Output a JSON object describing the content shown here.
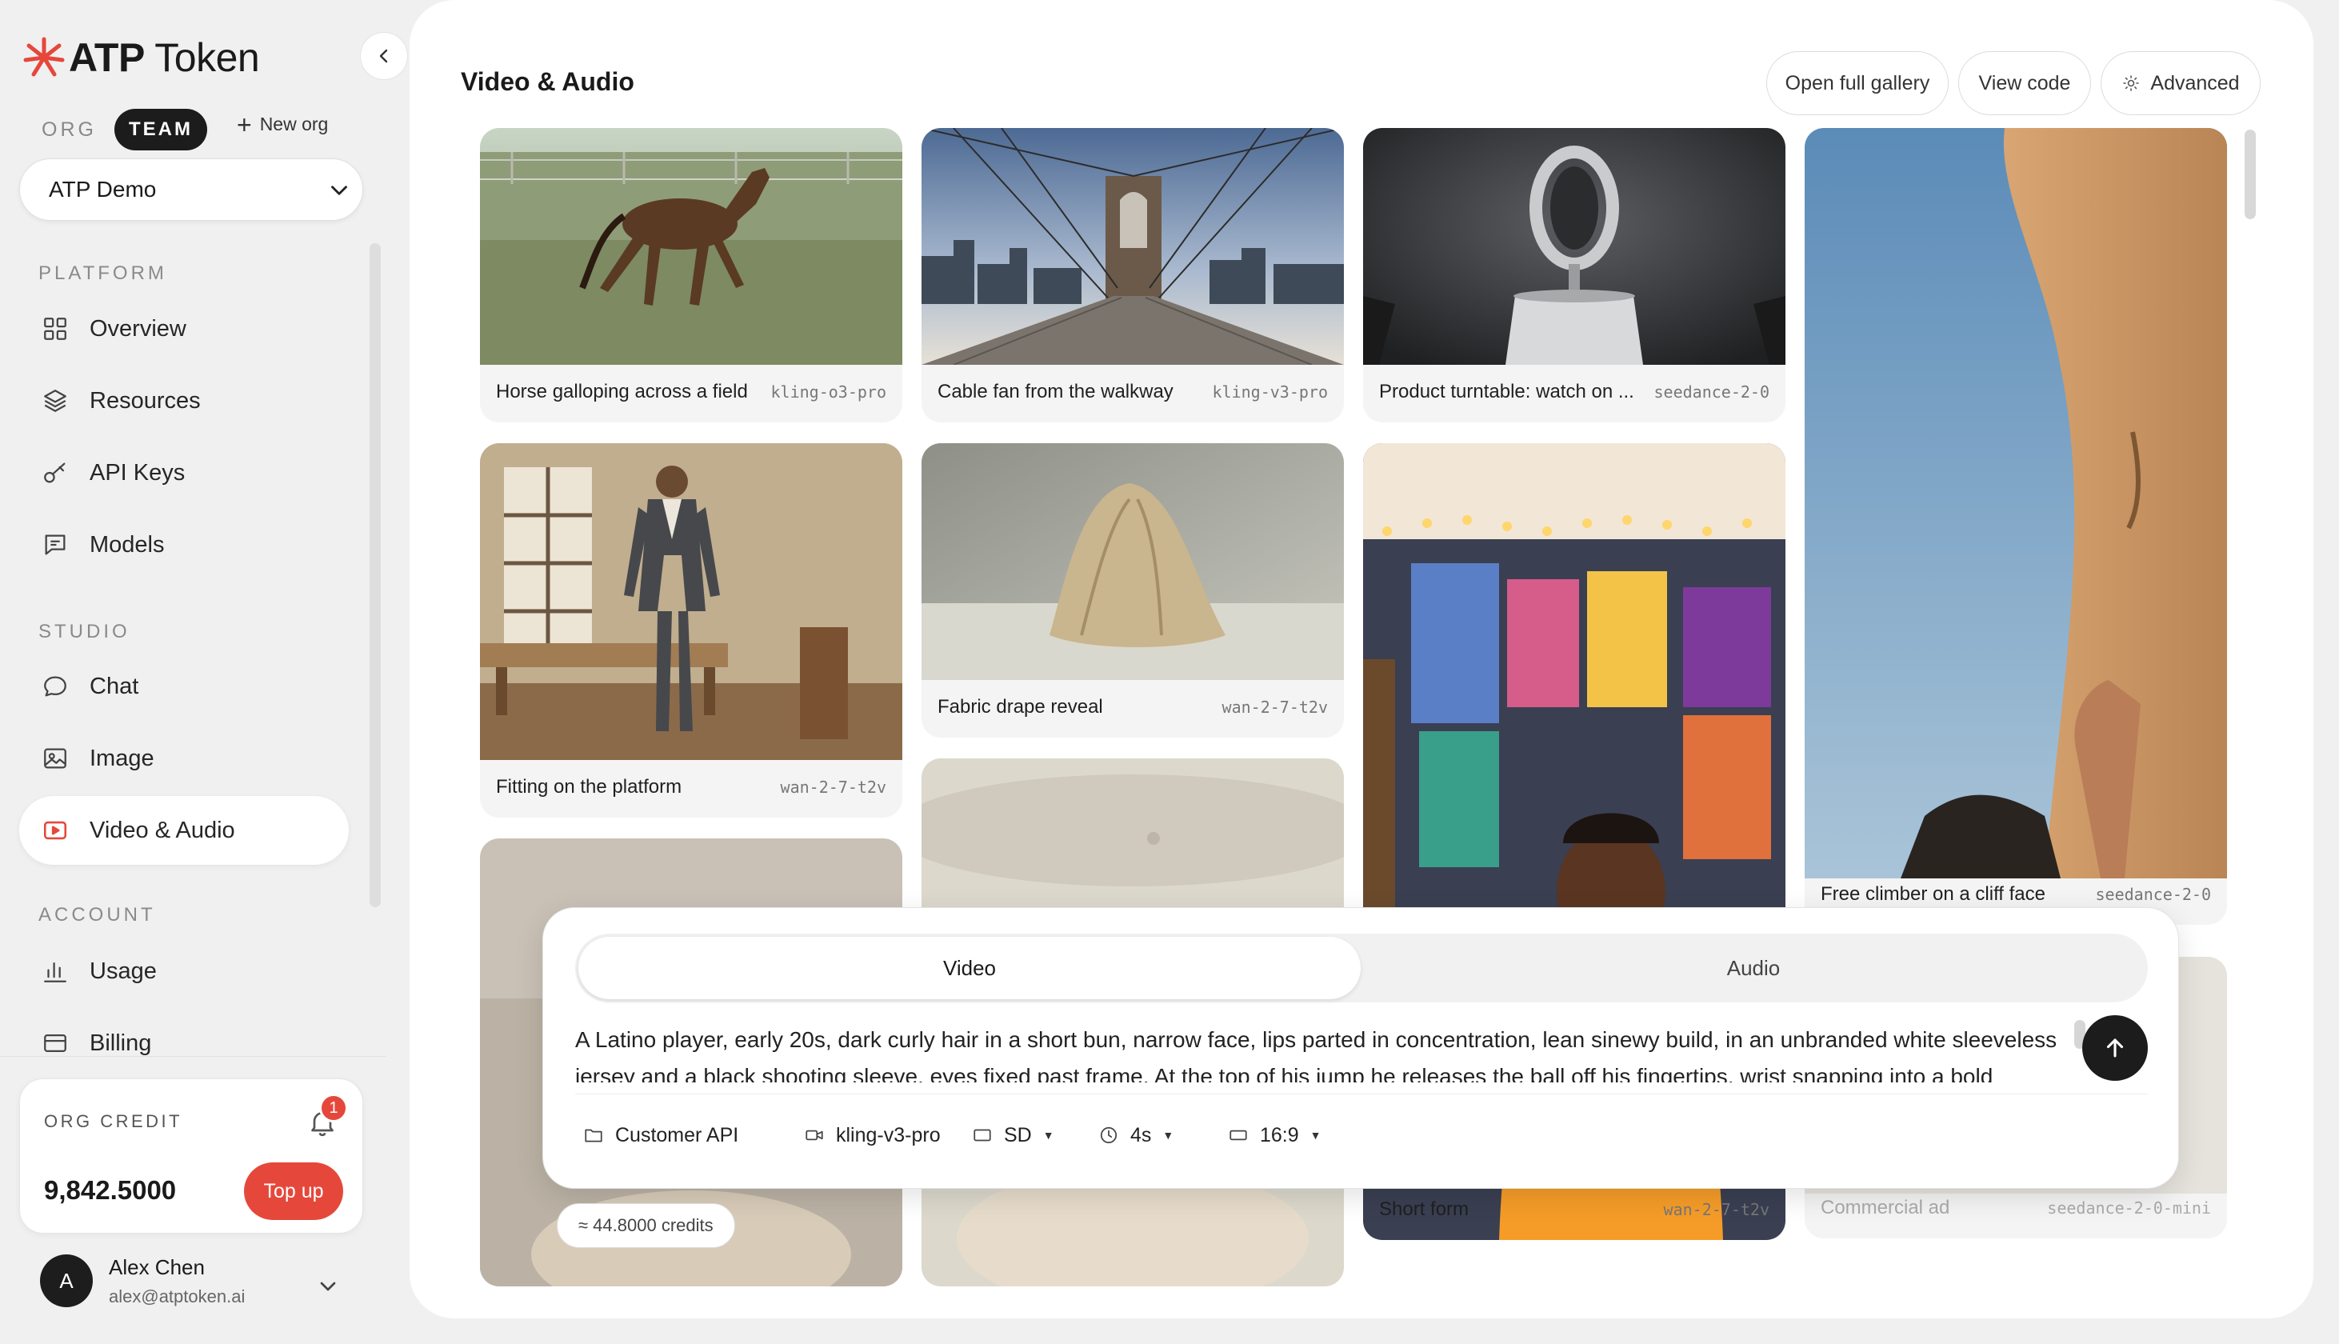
{
  "brand": {
    "name_bold": "ATP",
    "name_rest": " Token"
  },
  "org_switch": {
    "org_label": "ORG",
    "team_label": "TEAM",
    "new_org": "New org"
  },
  "org_select": {
    "value": "ATP Demo"
  },
  "sections": {
    "platform": "PLATFORM",
    "studio": "STUDIO",
    "account": "ACCOUNT"
  },
  "nav": {
    "overview": "Overview",
    "resources": "Resources",
    "api_keys": "API Keys",
    "models": "Models",
    "chat": "Chat",
    "image": "Image",
    "video_audio": "Video & Audio",
    "usage": "Usage",
    "billing": "Billing"
  },
  "credit": {
    "label": "ORG CREDIT",
    "value": "9,842.5000",
    "topup": "Top up",
    "notifications": "1"
  },
  "user": {
    "initial": "A",
    "name": "Alex Chen",
    "email": "alex@atptoken.ai"
  },
  "header": {
    "title": "Video & Audio",
    "open_gallery": "Open full gallery",
    "view_code": "View code",
    "advanced": "Advanced"
  },
  "gallery": [
    {
      "caption": "Horse galloping across a field",
      "model": "kling-o3-pro"
    },
    {
      "caption": "Cable fan from the walkway",
      "model": "kling-v3-pro"
    },
    {
      "caption": "Product turntable: watch on ...",
      "model": "seedance-2-0"
    },
    {
      "caption": "Free climber on a cliff face",
      "model": "seedance-2-0"
    },
    {
      "caption": "Fitting on the platform",
      "model": "wan-2-7-t2v"
    },
    {
      "caption": "Fabric drape reveal",
      "model": "wan-2-7-t2v"
    },
    {
      "caption": "Short form",
      "model": "wan-2-7-t2v"
    },
    {
      "caption": "Commercial ad",
      "model": "seedance-2-0-mini"
    }
  ],
  "composer": {
    "tab_video": "Video",
    "tab_audio": "Audio",
    "prompt": "A Latino player, early 20s, dark curly hair in a short bun, narrow face, lips parted in concentration, lean sinewy build, in an unbranded white sleeveless jersey and a black shooting sleeve, eyes fixed past frame. At the top of his jump he releases the ball off his fingertips, wrist snapping into a bold",
    "project": "Customer API",
    "model": "kling-v3-pro",
    "quality": "SD",
    "duration": "4s",
    "aspect": "16:9"
  },
  "cost": "≈ 44.8000 credits",
  "colors": {
    "accent": "#e5483b",
    "dark": "#1c1c1c",
    "background": "#f0f0f0"
  }
}
